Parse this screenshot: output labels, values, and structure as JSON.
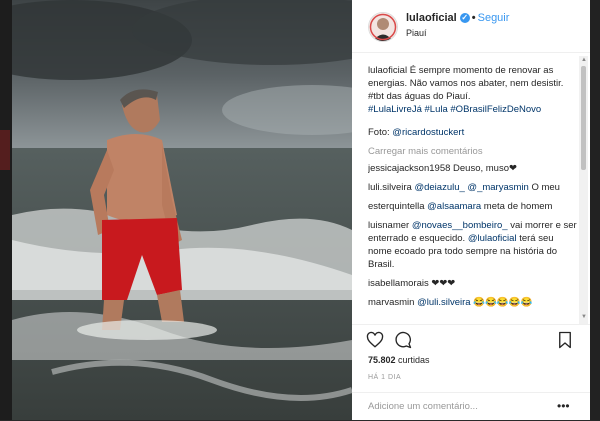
{
  "post": {
    "username": "lulaoficial",
    "verified_mark": "✓",
    "dot": "•",
    "follow_label": "Seguir",
    "location": "Piauí",
    "photo_alt": "Man in red shorts walking in the sea under a cloudy sky"
  },
  "caption": {
    "user": "lulaoficial",
    "text": " É sempre momento de renovar as energias. Não vamos nos abater, nem desistir. #tbt das águas do Piauí.",
    "hashtags": "#LulaLivreJá #Lula #OBrasilFelizDeNovo",
    "credit_prefix": "Foto: ",
    "credit_user": "@ricardostuckert"
  },
  "load_more": "Carregar mais comentários",
  "comments": [
    {
      "user": "jessicajackson1958",
      "text": " Deuso, muso❤"
    },
    {
      "user": "luli.silveira",
      "mention": "@deiazulu_ @_maryasmin",
      "text": " O meu"
    },
    {
      "user": "esterquintella",
      "mention": "@alsaamara",
      "text": " meta de homem"
    },
    {
      "user": "luisnamer",
      "mention": "@novaes__bombeiro_",
      "text": " vai morrer e ser enterrado e esquecido.",
      "mention2": "@lulaoficial",
      "text2": " terá seu nome ecoado pra todo sempre na história do Brasil."
    },
    {
      "user": "isabellamorais",
      "text": " ❤❤❤"
    },
    {
      "user": "marvasmin",
      "mention": "@luli.silveira",
      "text": " 😂😂😂😂😂"
    }
  ],
  "actions": {
    "like_icon": "heart-outline-icon",
    "comment_icon": "comment-bubble-icon",
    "save_icon": "bookmark-icon"
  },
  "likes": {
    "count": "75.802",
    "label": " curtidas"
  },
  "timestamp": "HÁ 1 DIA",
  "add_comment": {
    "placeholder": "Adicione um comentário...",
    "more": "•••"
  },
  "colors": {
    "link": "#003569",
    "follow": "#3897f0",
    "verified": "#3897f0",
    "shorts": "#c8191e"
  }
}
